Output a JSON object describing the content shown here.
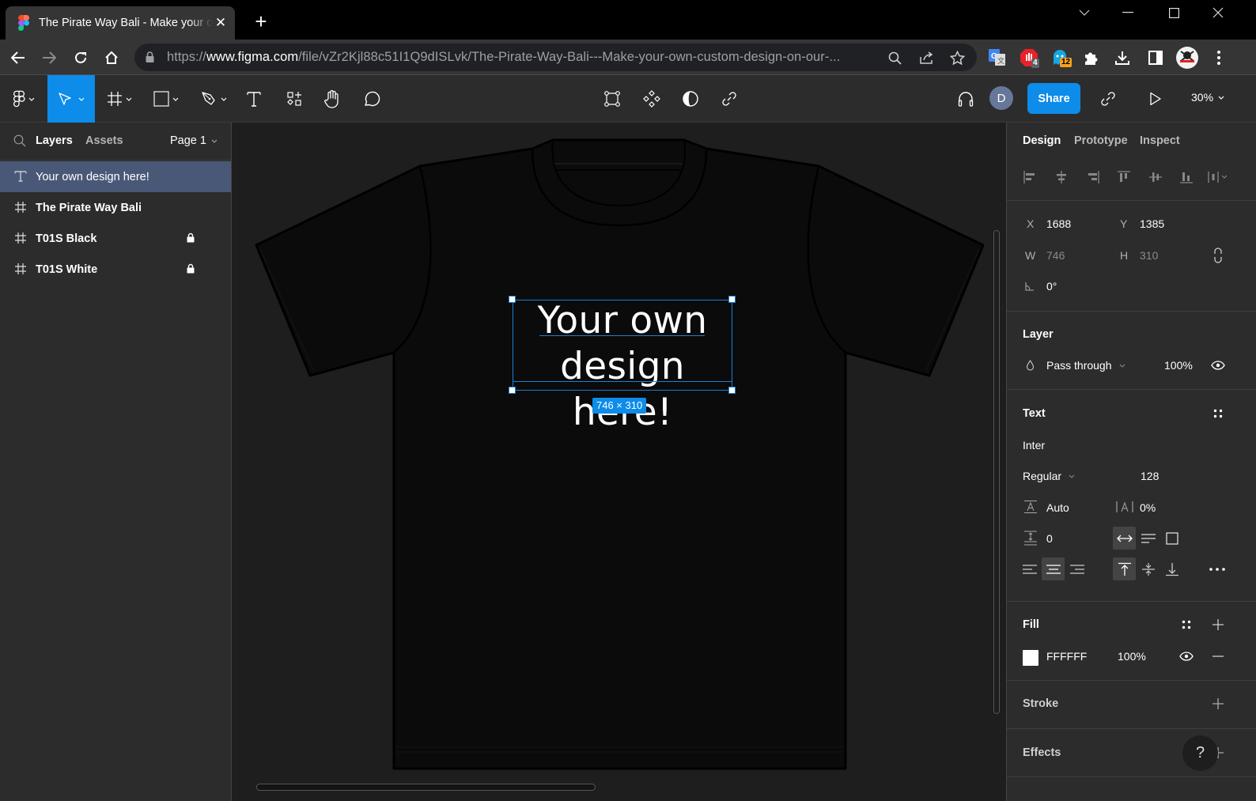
{
  "browser": {
    "tab_title": "The Pirate Way Bali - Make your own custom design on our",
    "tab_close": "✕",
    "new_tab": "+",
    "url_scheme": "https://",
    "url_host": "www.figma.com",
    "url_path": "/file/vZr2Kjl88c51I1Q9dISLvk/The-Pirate-Way-Bali---Make-your-own-custom-design-on-our-...",
    "extensions": [
      {
        "name": "google-translate",
        "badge": ""
      },
      {
        "name": "adblock",
        "badge": "4"
      },
      {
        "name": "ghostery",
        "badge": "12"
      },
      {
        "name": "extensions-puzzle",
        "badge": ""
      },
      {
        "name": "downloads",
        "badge": ""
      },
      {
        "name": "side-panel",
        "badge": ""
      },
      {
        "name": "profile",
        "badge": ""
      },
      {
        "name": "menu",
        "badge": ""
      }
    ]
  },
  "figma_toolbar": {
    "tools": [
      "main-menu",
      "move",
      "frame",
      "shape",
      "pen",
      "text",
      "resources",
      "hand",
      "comment"
    ],
    "active_tool": "move",
    "center_tools": [
      "edit-object",
      "component",
      "mask",
      "link"
    ],
    "avatar_initial": "D",
    "share_label": "Share",
    "zoom_label": "30%"
  },
  "left_panel": {
    "tabs": {
      "layers": "Layers",
      "assets": "Assets"
    },
    "active_tab": "Layers",
    "page": "Page 1",
    "layers": [
      {
        "type": "text",
        "label": "Your own design here!",
        "selected": true,
        "locked": false
      },
      {
        "type": "frame",
        "label": "The Pirate Way Bali",
        "selected": false,
        "locked": false
      },
      {
        "type": "frame",
        "label": "T01S Black",
        "selected": false,
        "locked": true
      },
      {
        "type": "frame",
        "label": "T01S White",
        "selected": false,
        "locked": true
      }
    ]
  },
  "canvas": {
    "design_text_line1": "Your own",
    "design_text_line2": "design here!",
    "dimension_badge": "746 × 310",
    "selection_color": "#1a7fd4"
  },
  "right_panel": {
    "tabs": {
      "design": "Design",
      "prototype": "Prototype",
      "inspect": "Inspect"
    },
    "active_tab": "Design",
    "x_label": "X",
    "x_value": "1688",
    "y_label": "Y",
    "y_value": "1385",
    "w_label": "W",
    "w_value": "746",
    "h_label": "H",
    "h_value": "310",
    "rotation": "0°",
    "layer": {
      "title": "Layer",
      "blend_mode": "Pass through",
      "opacity": "100%"
    },
    "text": {
      "title": "Text",
      "font_family": "Inter",
      "font_weight": "Regular",
      "font_size": "128",
      "line_height": "Auto",
      "letter_spacing": "0%",
      "paragraph_spacing": "0",
      "resizing": "auto-width",
      "align_horizontal": "center",
      "align_vertical": "top"
    },
    "fill": {
      "title": "Fill",
      "hex": "FFFFFF",
      "opacity": "100%",
      "color": "#FFFFFF"
    },
    "stroke": {
      "title": "Stroke"
    },
    "effects": {
      "title": "Effects"
    },
    "help": "?"
  },
  "colors": {
    "accent": "#0d8ce9",
    "panel_bg": "#2c2c2c",
    "canvas_bg": "#1e1e1e",
    "selected_layer_bg": "#4a5878"
  }
}
